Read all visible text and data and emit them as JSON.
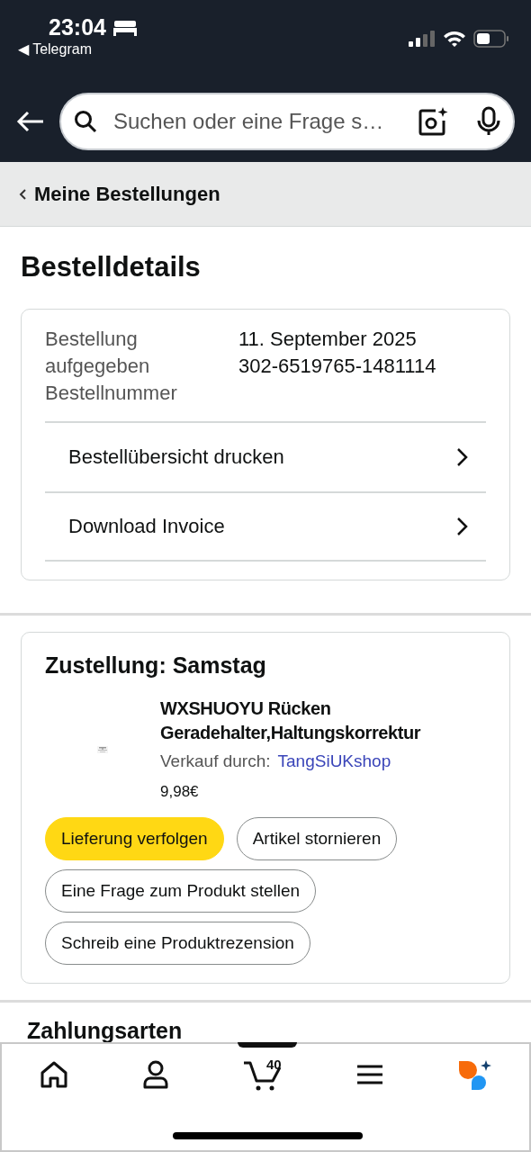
{
  "status_bar": {
    "time": "23:04",
    "back_app": "◀ Telegram"
  },
  "search": {
    "placeholder": "Suchen oder eine Frage s…"
  },
  "breadcrumb": {
    "label": "Meine Bestellungen"
  },
  "page_title": "Bestelldetails",
  "order": {
    "labels": [
      "Bestellung aufgegeben",
      "Bestellnummer"
    ],
    "values": [
      "11. September 2025",
      "302-6519765-1481114"
    ],
    "links": [
      "Bestellübersicht drucken",
      "Download Invoice"
    ]
  },
  "delivery": {
    "heading": "Zustellung: Samstag",
    "item": {
      "kind": "picture",
      "title": "WXSHUOYU Rücken Geradehalter,Haltungskorrektur",
      "seller_label": "Verkauf durch:",
      "seller": "TangSiUKshop",
      "price": "9,98€"
    },
    "actions": [
      {
        "label": "Lieferung verfolgen",
        "kind": "primary"
      },
      {
        "label": "Artikel stornieren",
        "kind": "secondary"
      },
      {
        "label": "Eine Frage zum Produkt stellen",
        "kind": "secondary"
      },
      {
        "label": "Schreib eine Produktrezension",
        "kind": "secondary"
      }
    ]
  },
  "next_section": "Zahlungsarten",
  "bottom_nav": {
    "cart_count": "40"
  }
}
